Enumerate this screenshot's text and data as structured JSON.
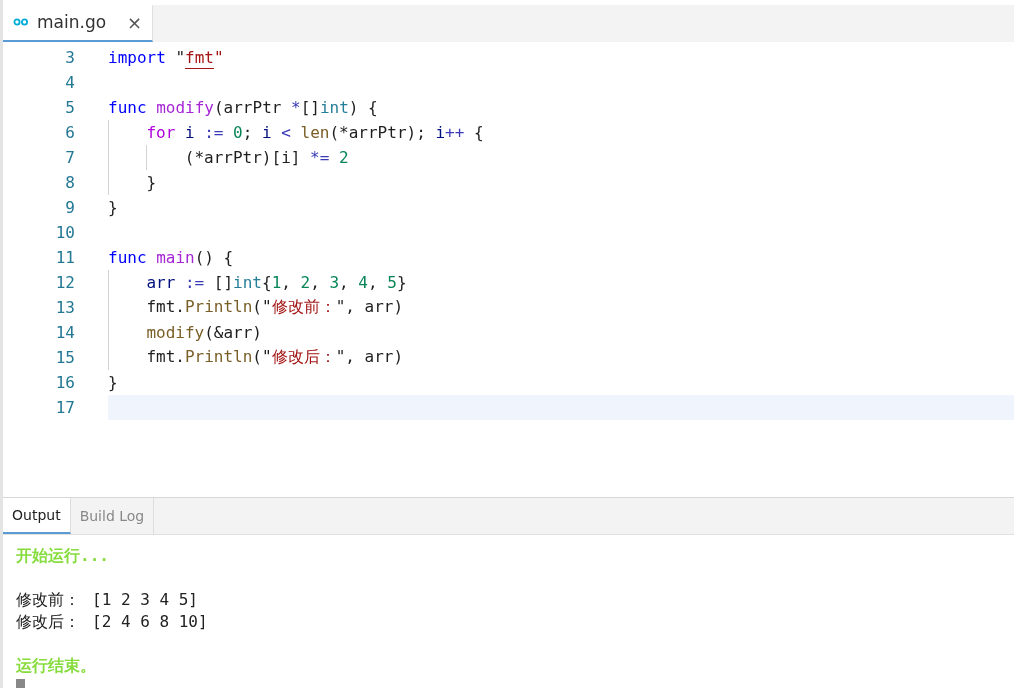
{
  "editor_tabs": [
    {
      "label": "main.go",
      "selected": true,
      "close": "×"
    }
  ],
  "code_lines": [
    {
      "number": "3",
      "selected": false,
      "tokens": [
        {
          "kind": "kw",
          "text": "import"
        },
        {
          "kind": "plain",
          "text": " \""
        },
        {
          "kind": "str",
          "text": "fmt",
          "underline": true
        },
        {
          "kind": "str",
          "text": "\""
        }
      ]
    },
    {
      "number": "4",
      "selected": false
    },
    {
      "number": "5",
      "selected": false,
      "tokens": [
        {
          "kind": "kw",
          "text": "func"
        },
        {
          "kind": "fn",
          "text": " modify"
        },
        {
          "kind": "plain",
          "text": "(arrPtr "
        },
        {
          "kind": "op",
          "text": "*"
        },
        {
          "kind": "plain",
          "text": "[]"
        },
        {
          "kind": "type",
          "text": "int"
        },
        {
          "kind": "plain",
          "text": ") {"
        }
      ],
      "children": [
        {
          "number": "6",
          "selected": false,
          "tokens": [
            {
              "kind": "ctl",
              "text": "for"
            },
            {
              "kind": "var",
              "text": " i "
            },
            {
              "kind": "op",
              "text": ":="
            },
            {
              "kind": "num",
              "text": " 0"
            },
            {
              "kind": "plain",
              "text": "; "
            },
            {
              "kind": "var",
              "text": "i"
            },
            {
              "kind": "op",
              "text": " < "
            },
            {
              "kind": "call",
              "text": "len"
            },
            {
              "kind": "plain",
              "text": "(*arrPtr); "
            },
            {
              "kind": "var",
              "text": "i"
            },
            {
              "kind": "op",
              "text": "++"
            },
            {
              "kind": "plain",
              "text": " {"
            }
          ],
          "children": [
            {
              "number": "7",
              "selected": false,
              "tokens": [
                {
                  "kind": "plain",
                  "text": "(*arrPtr)[i] "
                },
                {
                  "kind": "op",
                  "text": "*="
                },
                {
                  "kind": "num",
                  "text": " 2"
                }
              ]
            }
          ]
        },
        {
          "number": "8",
          "selected": false,
          "tokens": [
            {
              "kind": "plain",
              "text": "}"
            }
          ]
        }
      ]
    },
    {
      "number": "9",
      "selected": false,
      "tokens": [
        {
          "kind": "plain",
          "text": "}"
        }
      ]
    },
    {
      "number": "10",
      "selected": false
    },
    {
      "number": "11",
      "selected": false,
      "tokens": [
        {
          "kind": "kw",
          "text": "func"
        },
        {
          "kind": "fn",
          "text": " main"
        },
        {
          "kind": "plain",
          "text": "() {"
        }
      ],
      "children": [
        {
          "number": "12",
          "selected": false,
          "tokens": [
            {
              "kind": "var",
              "text": "arr"
            },
            {
              "kind": "op",
              "text": " := "
            },
            {
              "kind": "plain",
              "text": "[]"
            },
            {
              "kind": "type",
              "text": "int"
            },
            {
              "kind": "plain",
              "text": "{"
            },
            {
              "kind": "num",
              "text": "1"
            },
            {
              "kind": "plain",
              "text": ", "
            },
            {
              "kind": "num",
              "text": "2"
            },
            {
              "kind": "plain",
              "text": ", "
            },
            {
              "kind": "num",
              "text": "3"
            },
            {
              "kind": "plain",
              "text": ", "
            },
            {
              "kind": "num",
              "text": "4"
            },
            {
              "kind": "plain",
              "text": ", "
            },
            {
              "kind": "num",
              "text": "5"
            },
            {
              "kind": "plain",
              "text": "}"
            }
          ]
        },
        {
          "number": "13",
          "selected": false,
          "tokens": [
            {
              "kind": "plain",
              "text": "fmt."
            },
            {
              "kind": "call",
              "text": "Println"
            },
            {
              "kind": "plain",
              "text": "(\""
            },
            {
              "kind": "str",
              "text": "修改前："
            },
            {
              "kind": "plain",
              "text": "\", arr)"
            }
          ]
        },
        {
          "number": "14",
          "selected": false,
          "tokens": [
            {
              "kind": "call",
              "text": "modify"
            },
            {
              "kind": "plain",
              "text": "(&arr)"
            }
          ]
        },
        {
          "number": "15",
          "selected": false,
          "tokens": [
            {
              "kind": "plain",
              "text": "fmt."
            },
            {
              "kind": "call",
              "text": "Println"
            },
            {
              "kind": "plain",
              "text": "(\""
            },
            {
              "kind": "str",
              "text": "修改后："
            },
            {
              "kind": "plain",
              "text": "\", arr)"
            }
          ]
        }
      ]
    },
    {
      "number": "16",
      "selected": false,
      "tokens": [
        {
          "kind": "plain",
          "text": "}"
        }
      ]
    },
    {
      "number": "17",
      "selected": true
    }
  ],
  "panel_tabs": [
    {
      "label": "Output",
      "selected": true
    },
    {
      "label": "Build Log",
      "selected": false
    }
  ],
  "output_lines": [
    {
      "kind": "status",
      "text": "开始运行..."
    },
    {
      "kind": "text",
      "label": "修改前：",
      "value": "[1 2 3 4 5]"
    },
    {
      "kind": "text",
      "label": "修改后：",
      "value": "[2 4 6 8 10]"
    },
    {
      "kind": "status",
      "text": "运行结束。"
    },
    {
      "kind": "cursor"
    }
  ]
}
